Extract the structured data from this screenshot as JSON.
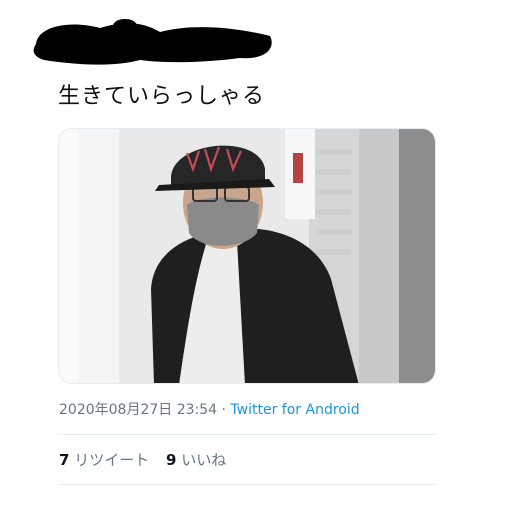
{
  "tweet": {
    "text": "生きていらっしゃる",
    "timestamp": "2020年08月27日 23:54",
    "separator": " · ",
    "source": "Twitter for Android"
  },
  "stats": {
    "retweets_count": "7",
    "retweets_label": "リツイート",
    "likes_count": "9",
    "likes_label": "いいね"
  },
  "colors": {
    "link": "#1b95e0",
    "meta": "#657786",
    "divider": "#e6ecf0",
    "redaction": "#000000"
  }
}
